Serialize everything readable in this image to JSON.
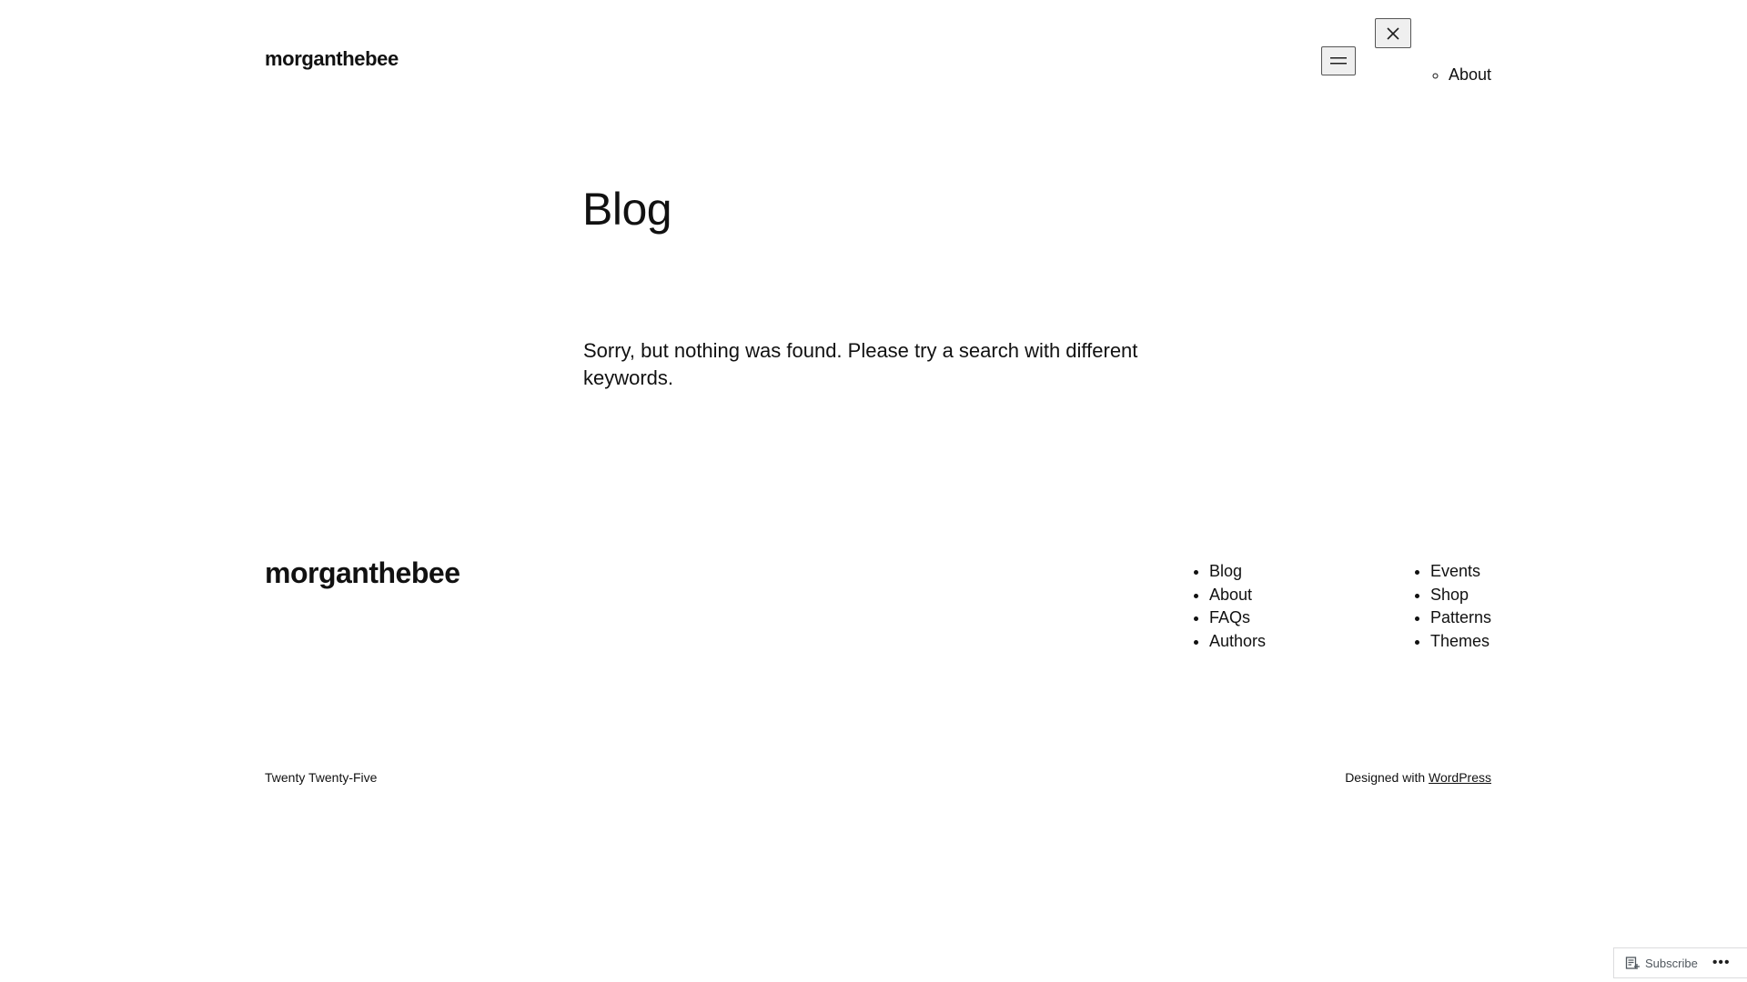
{
  "header": {
    "site_title": "morganthebee",
    "menu_open_icon": "hamburger-icon",
    "menu_close_icon": "close-icon",
    "overlay_nav": [
      "About"
    ]
  },
  "main": {
    "title": "Blog",
    "message": "Sorry, but nothing was found. Please try a search with different keywords."
  },
  "footer": {
    "site_title": "morganthebee",
    "nav_col_1": [
      "Blog",
      "About",
      "FAQs",
      "Authors"
    ],
    "nav_col_2": [
      "Events",
      "Shop",
      "Patterns",
      "Themes"
    ],
    "theme_name": "Twenty Twenty-Five",
    "credit_prefix": "Designed with",
    "credit_link": "WordPress"
  },
  "actionbar": {
    "subscribe_label": "Subscribe",
    "subscribe_icon": "reader-icon",
    "more_icon": "ellipsis-icon",
    "more_label": "•••"
  }
}
